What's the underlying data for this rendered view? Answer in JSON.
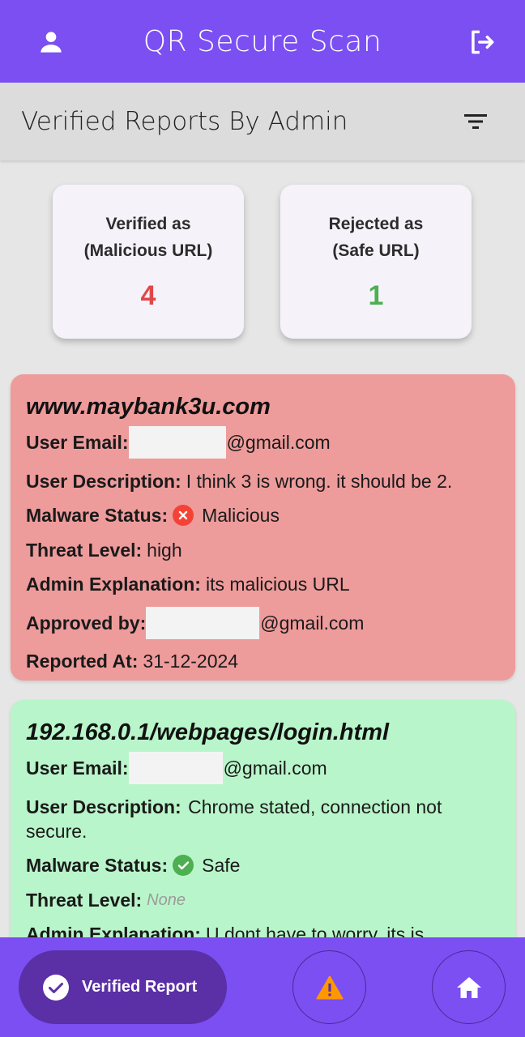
{
  "app": {
    "title": "QR Secure Scan"
  },
  "header": {
    "subtitle": "Verified Reports By Admin"
  },
  "stats": {
    "malicious": {
      "line1": "Verified as",
      "line2": "(Malicious URL)",
      "count": "4",
      "color": "#e04848"
    },
    "safe": {
      "line1": "Rejected as",
      "line2": "(Safe URL)",
      "count": "1",
      "color": "#4caf50"
    }
  },
  "reports": [
    {
      "url": "www.maybank3u.com",
      "email_label": "User Email:",
      "email_suffix": "@gmail.com",
      "desc_label": "User Description:",
      "desc": "I think 3 is wrong. it should be 2.",
      "status_label": "Malware Status:",
      "status": "Malicious",
      "threat_label": "Threat Level:",
      "threat": "high",
      "explanation_label": "Admin Explanation:",
      "explanation": "its malicious URL",
      "approved_label": "Approved by:",
      "approved_suffix": "@gmail.com",
      "reported_label": "Reported At:",
      "reported": "31-12-2024",
      "bg": "#ee9b9b"
    },
    {
      "url": "192.168.0.1/webpages/login.html",
      "email_label": "User Email:",
      "email_suffix": "@gmail.com",
      "desc_label": "User Description:",
      "desc": "Chrome stated, connection not secure.",
      "status_label": "Malware Status:",
      "status": "Safe",
      "threat_label": "Threat Level:",
      "threat": "None",
      "explanation_label": "Admin Explanation:",
      "explanation": "U dont have to worry, its is",
      "bg": "#b9f5ca"
    }
  ],
  "nav": {
    "verified_label": "Verified Report"
  },
  "icons": {
    "profile": "person-icon",
    "logout": "logout-icon",
    "filter": "filter-icon",
    "malicious": "cancel-circle-icon",
    "safe": "check-circle-icon",
    "verified": "check-circle-icon",
    "warning": "warning-icon",
    "home": "home-icon"
  },
  "colors": {
    "primary": "#7b4ff2",
    "nav_active": "#5b2fa6",
    "warning": "#ff9800",
    "malicious_badge": "#f44336",
    "safe_badge": "#4caf50"
  }
}
